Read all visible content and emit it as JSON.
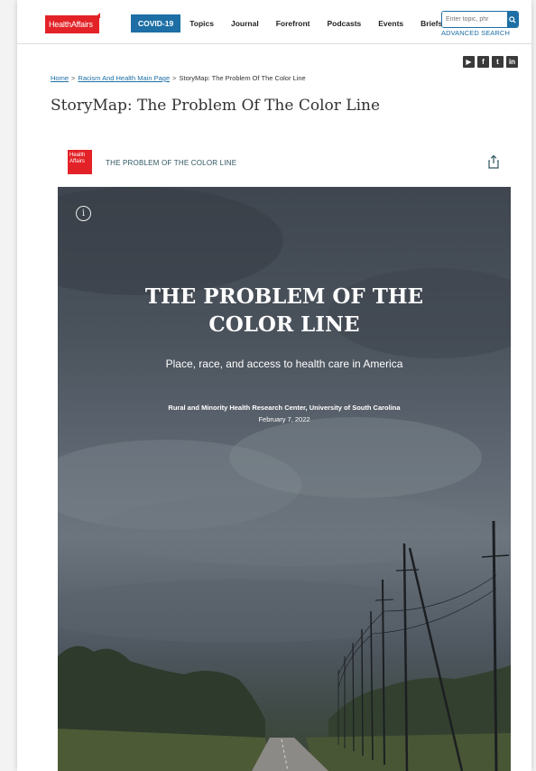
{
  "header": {
    "logo_text": "HealthAffairs",
    "nav": [
      "COVID-19",
      "Topics",
      "Journal",
      "Forefront",
      "Podcasts",
      "Events",
      "Briefs"
    ],
    "search_placeholder": "Enter topic, phr",
    "advanced_search": "ADVANCED SEARCH"
  },
  "social": {
    "youtube": "▶",
    "facebook": "f",
    "twitter": "t",
    "linkedin": "in"
  },
  "breadcrumb": {
    "home": "Home",
    "section": "Racism And Health Main Page",
    "current": "StoryMap: The Problem Of The Color Line",
    "separator": ">"
  },
  "page_title": "StoryMap: The Problem Of The Color Line",
  "storymap": {
    "logo_line1": "Health",
    "logo_line2": "Affairs",
    "header_title": "THE PROBLEM OF THE COLOR LINE",
    "hero": {
      "title_line1": "THE PROBLEM OF THE",
      "title_line2": "COLOR LINE",
      "subtitle": "Place, race, and access to health care in America",
      "author": "Rural and Minority Health Research Center, University of South Carolina",
      "date": "February 7, 2022",
      "info_icon": "i"
    }
  },
  "colors": {
    "brand_red": "#e32227",
    "link_blue": "#1d6fa5"
  }
}
